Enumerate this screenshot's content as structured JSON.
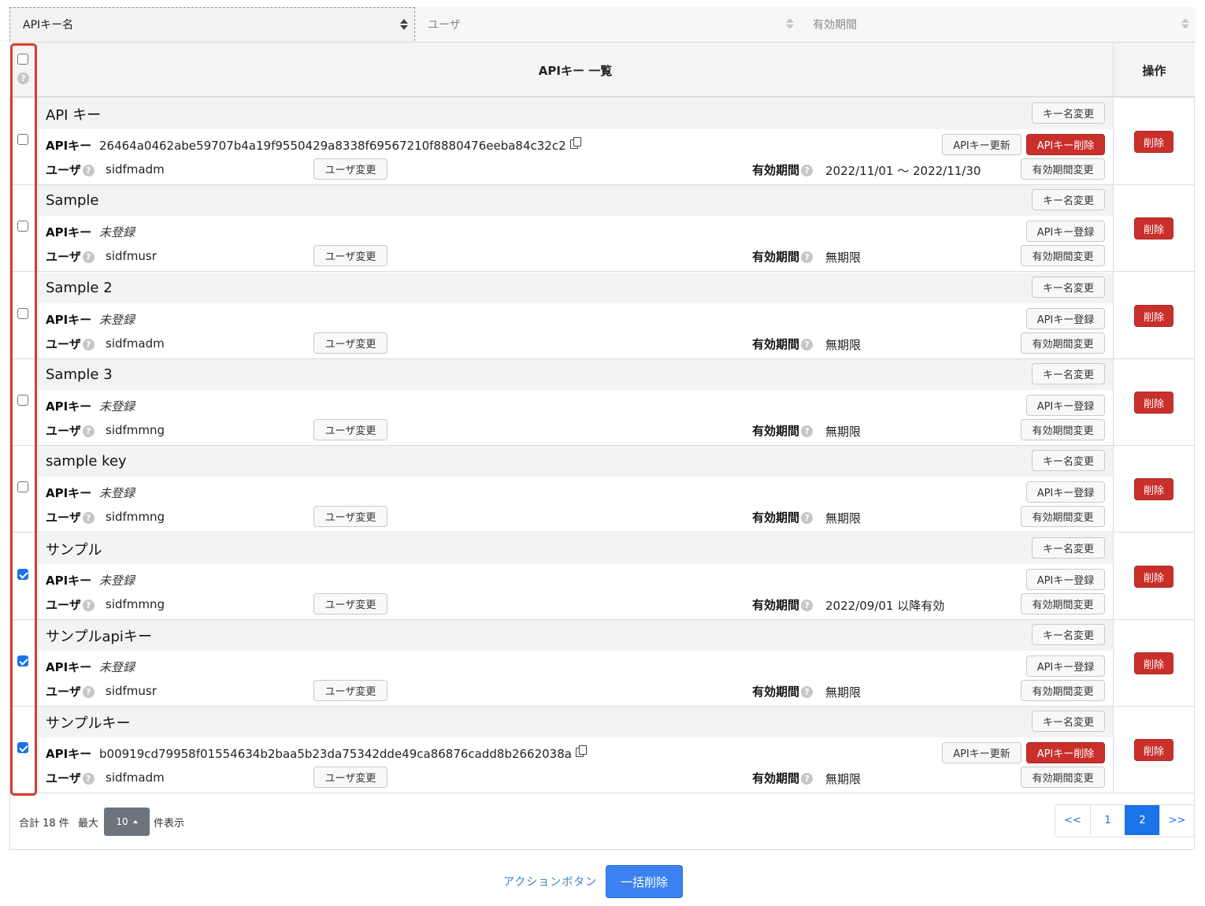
{
  "sort_bar": {
    "col1": "APIキー名",
    "col2": "ユーザ",
    "col3": "有効期間"
  },
  "table": {
    "header_title": "APIキー 一覧",
    "header_ops": "操作",
    "help_glyph": "?",
    "labels": {
      "api_key": "APIキー",
      "user": "ユーザ",
      "validity": "有効期間"
    },
    "buttons": {
      "rename": "キー名変更",
      "user_change": "ユーザ変更",
      "validity_change": "有効期間変更",
      "key_register": "APIキー登録",
      "key_update": "APIキー更新",
      "key_delete": "APIキー削除",
      "delete": "削除"
    },
    "rows": [
      {
        "name": "API キー",
        "api_key": "26464a0462abe59707b4a19f9550429a8338f69567210f8880476eeba84c32c2",
        "registered": true,
        "user": "sidfmadm",
        "validity": "2022/11/01 〜 2022/11/30",
        "checked": false
      },
      {
        "name": "Sample",
        "api_key": "未登録",
        "registered": false,
        "user": "sidfmusr",
        "validity": "無期限",
        "checked": false
      },
      {
        "name": "Sample 2",
        "api_key": "未登録",
        "registered": false,
        "user": "sidfmadm",
        "validity": "無期限",
        "checked": false
      },
      {
        "name": "Sample 3",
        "api_key": "未登録",
        "registered": false,
        "user": "sidfmmng",
        "validity": "無期限",
        "checked": false
      },
      {
        "name": "sample key",
        "api_key": "未登録",
        "registered": false,
        "user": "sidfmmng",
        "validity": "無期限",
        "checked": false
      },
      {
        "name": "サンプル",
        "api_key": "未登録",
        "registered": false,
        "user": "sidfmmng",
        "validity": "2022/09/01 以降有効",
        "checked": true
      },
      {
        "name": "サンプルapiキー",
        "api_key": "未登録",
        "registered": false,
        "user": "sidfmusr",
        "validity": "無期限",
        "checked": true
      },
      {
        "name": "サンプルキー",
        "api_key": "b00919cd79958f01554634b2baa5b23da75342dde49ca86876cadd8b2662038a",
        "registered": true,
        "user": "sidfmadm",
        "validity": "無期限",
        "checked": true
      }
    ]
  },
  "footer": {
    "total": "合計 18 件",
    "max": "最大",
    "per_page_value": "10",
    "per_page_suffix": "件表示",
    "pagination": {
      "first": "<<",
      "pages": [
        "1",
        "2"
      ],
      "current": "2",
      "last": ">>"
    }
  },
  "actions": {
    "label": "アクションボタン",
    "bulk_delete": "一括削除"
  },
  "colors": {
    "accent": "#1a73e8",
    "danger": "#c9302c",
    "highlight_frame": "#d93b2b"
  }
}
